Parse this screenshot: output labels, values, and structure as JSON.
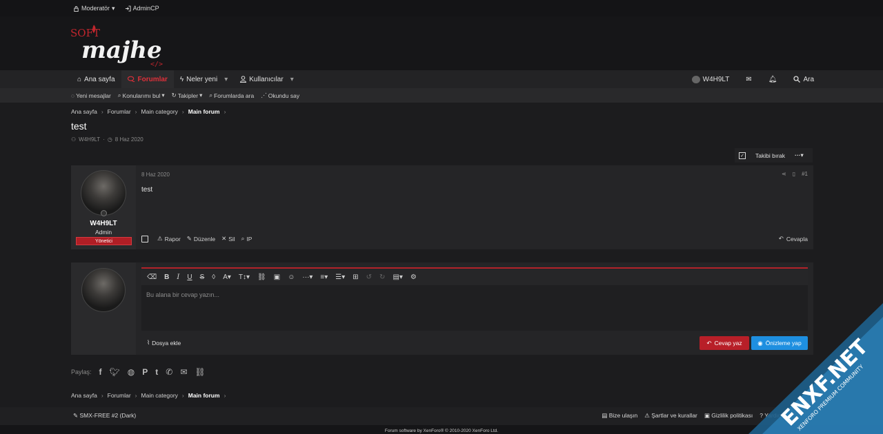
{
  "topbar": {
    "moderator": "Moderatör",
    "admincp": "AdminCP"
  },
  "logo": {
    "soft": "SOFT",
    "majhe": "majhe",
    "code": "</>"
  },
  "nav": {
    "items": [
      {
        "label": "Ana sayfa"
      },
      {
        "label": "Forumlar"
      },
      {
        "label": "Neler yeni"
      },
      {
        "label": "Kullanıcılar"
      }
    ],
    "user": "W4H9LT",
    "search": "Ara"
  },
  "subnav": [
    "Yeni mesajlar",
    "Konularımı bul",
    "Takipler",
    "Forumlarda ara",
    "Okundu say"
  ],
  "breadcrumb": [
    "Ana sayfa",
    "Forumlar",
    "Main category",
    "Main forum"
  ],
  "thread": {
    "title": "test",
    "author": "W4H9LT",
    "date": "8 Haz 2020",
    "follow_label": "Takibi bırak"
  },
  "post": {
    "date": "8 Haz 2020",
    "number": "#1",
    "body": "test",
    "username": "W4H9LT",
    "user_title": "Admin",
    "badge": "Yönetici",
    "actions": [
      "Rapor",
      "Düzenle",
      "Sil",
      "IP"
    ],
    "reply_label": "Cevapla"
  },
  "reply": {
    "placeholder": "Bu alana bir cevap yazın...",
    "attach_label": "Dosya ekle",
    "submit_label": "Cevap yaz",
    "preview_label": "Önizleme yap"
  },
  "share": {
    "label": "Paylaş:"
  },
  "footer": {
    "style": "SMX-FREE #2 (Dark)",
    "links": [
      "Bize ulaşın",
      "Şartlar ve kurallar",
      "Gizlilik politikası",
      "Yardım"
    ],
    "copyright": "Forum software by XenForo® © 2010-2020 XenForo Ltd."
  },
  "watermark": {
    "brand": "ENXF.NET",
    "tagline": "XENFORO PREMIUM COMMUNITY"
  },
  "colors": {
    "accent": "#b81f28",
    "preview": "#1e8fe0",
    "bg": "#1c1c1e"
  }
}
